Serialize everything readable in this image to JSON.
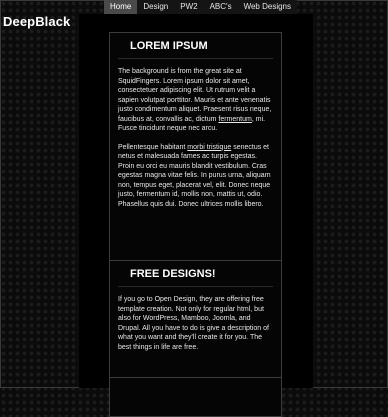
{
  "site": {
    "title": "DeepBlack"
  },
  "nav": {
    "items": [
      {
        "label": "Home",
        "active": true
      },
      {
        "label": "Design",
        "active": false
      },
      {
        "label": "PW2",
        "active": false
      },
      {
        "label": "ABC's",
        "active": false
      },
      {
        "label": "Web Designs",
        "active": false
      }
    ]
  },
  "posts": [
    {
      "title": "LOREM IPSUM",
      "p1_a": "The background is from the great site at SquidFingers. Lorem ipsum dolor sit amet, consectetuer adipiscing elit. Ut rutrum velit a sapien volutpat porttitor. Mauris et ante venenatis justo condimentum aliquet. Praesent risus neque, faucibus at, convallis ac, dictum ",
      "p1_link": "fermentum",
      "p1_b": ", mi. Fusce tincidunt neque nec arcu.",
      "p2_a": "Pellentesque habitant ",
      "p2_link": "morbi tristique",
      "p2_b": " senectus et netus et malesuada fames ac turpis egestas. Proin eu orci eu mauris blandit vestibulum. Cras egestas magna vitae felis. In purus urna, aliquam non, tempus eget, placerat vel, elit. Donec neque justo, fermentum id, mollis non, mattis ut, odio. Phasellus quis dui. Donec ultrices mollis libero."
    },
    {
      "title": "FREE DESIGNS!",
      "p1": "If you go to Open Design, they are offering free template creation. Not only for regular html, but also for WordPress, Mamboo, Joomla, and Drupal. All you have to do is give a description of what you want and they'll create it for you. The best things in life are free."
    }
  ]
}
